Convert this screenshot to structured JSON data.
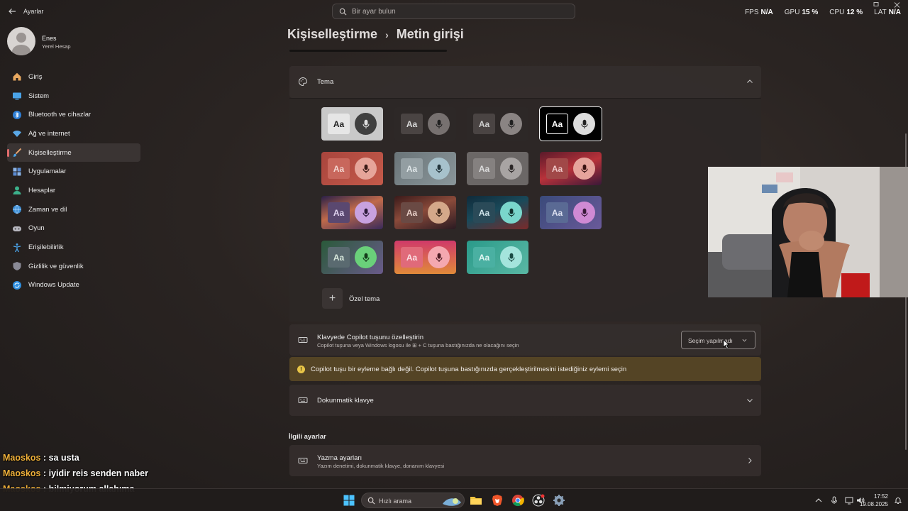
{
  "app": {
    "title": "Ayarlar"
  },
  "search": {
    "placeholder": "Bir ayar bulun"
  },
  "stats": [
    {
      "label": "FPS",
      "value": "N/A"
    },
    {
      "label": "GPU",
      "value": "15 %"
    },
    {
      "label": "CPU",
      "value": "12 %"
    },
    {
      "label": "LAT",
      "value": "N/A"
    }
  ],
  "profile": {
    "name": "Enes",
    "account": "Yerel Hesap"
  },
  "sidebar": {
    "items": [
      {
        "label": "Giriş",
        "icon": "home-icon"
      },
      {
        "label": "Sistem",
        "icon": "monitor-icon"
      },
      {
        "label": "Bluetooth ve cihazlar",
        "icon": "bluetooth-icon"
      },
      {
        "label": "Ağ ve internet",
        "icon": "wifi-icon"
      },
      {
        "label": "Kişiselleştirme",
        "icon": "brush-icon",
        "active": true
      },
      {
        "label": "Uygulamalar",
        "icon": "apps-icon"
      },
      {
        "label": "Hesaplar",
        "icon": "person-icon"
      },
      {
        "label": "Zaman ve dil",
        "icon": "globe-clock-icon"
      },
      {
        "label": "Oyun",
        "icon": "gamepad-icon"
      },
      {
        "label": "Erişilebilirlik",
        "icon": "accessibility-icon"
      },
      {
        "label": "Gizlilik ve güvenlik",
        "icon": "shield-icon"
      },
      {
        "label": "Windows Update",
        "icon": "update-icon"
      }
    ]
  },
  "breadcrumb": {
    "parent": "Kişiselleştirme",
    "current": "Metin girişi"
  },
  "theme_section": {
    "title": "Tema",
    "tile_label": "Aa",
    "custom_label": "Özel tema",
    "tiles": [
      {
        "bg": "#c9c9c9",
        "aa_bg": "#e6e6e6",
        "aa_fg": "#222222",
        "mic_bg": "#404040",
        "mic_fg": "#e0e0e0"
      },
      {
        "bg": "#2d2827",
        "aa_bg": "#4a4443",
        "aa_fg": "#d8d8d8",
        "mic_bg": "#777170",
        "mic_fg": "#202020"
      },
      {
        "bg": "#2d2827",
        "aa_bg": "#4a4443",
        "aa_fg": "#cfcfcf",
        "mic_bg": "#8a8483",
        "mic_fg": "#202020"
      },
      {
        "bg": "#000000",
        "aa_bg": "#000000",
        "aa_fg": "#ffffff",
        "mic_bg": "#dcdcdc",
        "mic_fg": "#202020",
        "selected": true
      },
      {
        "bg": "linear-gradient(135deg,#a9453d,#c45a4a)",
        "aa_bg": "#c8675c",
        "aa_fg": "#f4d8d2",
        "mic_bg": "#e6a59a",
        "mic_fg": "#3a1a16"
      },
      {
        "bg": "linear-gradient(135deg,#6a7478,#8a969a)",
        "aa_bg": "#939ea2",
        "aa_fg": "#dfe6e8",
        "mic_bg": "#a7c2cc",
        "mic_fg": "#22343a"
      },
      {
        "bg": "#6b6766",
        "aa_bg": "#858180",
        "aa_fg": "#dcdcdc",
        "mic_bg": "#a8a4a3",
        "mic_fg": "#2a2626"
      },
      {
        "bg": "linear-gradient(160deg,#5a1a2a,#b8323a 50%,#3a1838)",
        "aa_bg": "#a14848",
        "aa_fg": "#f0c8c8",
        "mic_bg": "#e6a49c",
        "mic_fg": "#3a1212"
      },
      {
        "bg": "linear-gradient(160deg,#2a2048,#c06a4a 45%,#3a2a5a)",
        "aa_bg": "#5a4870",
        "aa_fg": "#e0d4f0",
        "mic_bg": "#c8a2e0",
        "mic_fg": "#2a1a3a"
      },
      {
        "bg": "linear-gradient(160deg,#3a1a1a,#8a4a3a 45%,#2a1a22)",
        "aa_bg": "#6a4a44",
        "aa_fg": "#e8d0c8",
        "mic_bg": "#d4a88a",
        "mic_fg": "#3a2418"
      },
      {
        "bg": "linear-gradient(160deg,#102a3a,#1a4a5a 45%,#7a2a2a)",
        "aa_bg": "#2a4a58",
        "aa_fg": "#d0e4ea",
        "mic_bg": "#7ad6cc",
        "mic_fg": "#10302c"
      },
      {
        "bg": "linear-gradient(135deg,#3a4a7a,#6a5a9a)",
        "aa_bg": "#5a6a94",
        "aa_fg": "#dce0f0",
        "mic_bg": "#d08ad4",
        "mic_fg": "#3a1a3a"
      },
      {
        "bg": "linear-gradient(135deg,#2a5a3a,#6a5a8a)",
        "aa_bg": "#5a6a70",
        "aa_fg": "#d8e8dc",
        "mic_bg": "#6ad07a",
        "mic_fg": "#143a1a"
      },
      {
        "bg": "linear-gradient(180deg,#d03a6a,#e08a3a)",
        "aa_bg": "#e06a7a",
        "aa_fg": "#fbe0e4",
        "mic_bg": "#f4a8b0",
        "mic_fg": "#4a1a22"
      },
      {
        "bg": "linear-gradient(135deg,#2a9a8a,#5ab8a4)",
        "aa_bg": "#4ab0a2",
        "aa_fg": "#e0f6f2",
        "mic_bg": "#a4e4dc",
        "mic_fg": "#1a4a44"
      }
    ]
  },
  "copilot_row": {
    "title": "Klavyede Copilot tuşunu özelleştirin",
    "subtitle": "Copilot tuşuna veya Windows logosu ile ⊞ + C tuşuna bastığınızda ne olacağını seçin",
    "dropdown_value": "Seçim yapılmadı"
  },
  "warning": {
    "text": "Copilot tuşu bir eyleme bağlı değil. Copilot tuşuna bastığınızda gerçekleştirilmesini istediğiniz eylemi seçin"
  },
  "touch_keyboard_row": {
    "title": "Dokunmatik klavye"
  },
  "related": {
    "heading": "İlgili ayarlar",
    "typing_title": "Yazma ayarları",
    "typing_subtitle": "Yazım denetimi, dokunmatik klavye, donanım klavyesi"
  },
  "chat": [
    {
      "user": "Maoskos",
      "message": "sa usta"
    },
    {
      "user": "Maoskos",
      "message": "iyidir reis senden naber"
    },
    {
      "user": "Maoskos",
      "message": "bilmiyorum allahıma"
    }
  ],
  "taskbar": {
    "search_placeholder": "Hızlı arama",
    "time": "17:52",
    "date": "19.08.2025"
  },
  "colors": {
    "accent": "#e06c6c",
    "warning_bg": "#5c4a26",
    "chat_user": "#f0b13a"
  }
}
